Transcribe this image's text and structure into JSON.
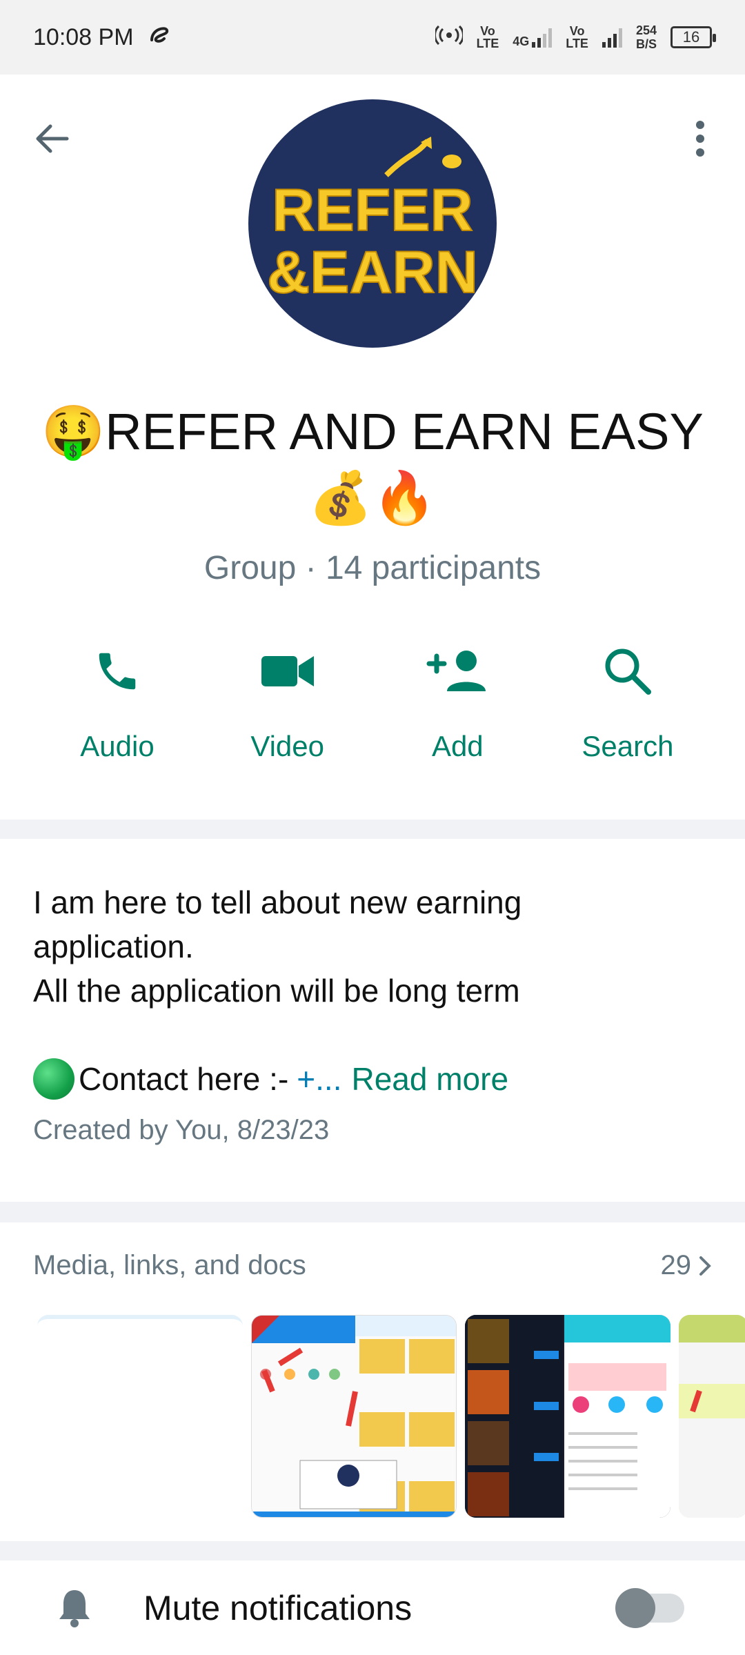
{
  "status_bar": {
    "time": "10:08 PM",
    "sim1_label_top": "Vo",
    "sim1_label_bottom": "LTE",
    "network_type": "4G",
    "sim2_label_top": "Vo",
    "sim2_label_bottom": "LTE",
    "net_speed_value": "254",
    "net_speed_unit": "B/S",
    "battery_level": "16"
  },
  "header": {
    "avatar_logo_line1": "REFER",
    "avatar_logo_line2": "&EARN",
    "group_name": "🤑REFER AND EARN EASY 💰🔥",
    "group_subtitle": "Group · 14 participants"
  },
  "actions": [
    {
      "label": "Audio",
      "icon": "phone-icon"
    },
    {
      "label": "Video",
      "icon": "video-icon"
    },
    {
      "label": "Add",
      "icon": "add-person-icon"
    },
    {
      "label": "Search",
      "icon": "search-icon"
    }
  ],
  "description": {
    "line1": "I am here to tell about new earning",
    "line2": "application.",
    "line3": "All the application will be long term",
    "contact_text": "Contact here :- ",
    "contact_link": "+...",
    "read_more": "Read more",
    "created": "Created by You, 8/23/23"
  },
  "media": {
    "title": "Media, links, and docs",
    "count": "29"
  },
  "mute": {
    "label": "Mute notifications",
    "enabled": false
  },
  "colors": {
    "accent": "#008069",
    "muted_text": "#667781",
    "link": "#027eb5",
    "avatar_bg": "#20305f",
    "logo_yellow": "#f7c928"
  }
}
